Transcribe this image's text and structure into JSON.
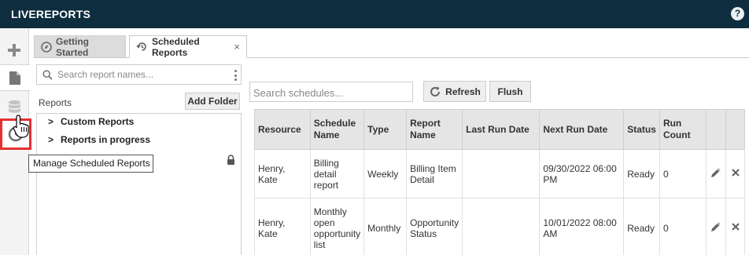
{
  "app": {
    "title": "LIVEREPORTS",
    "help_icon": "question-circle-icon",
    "help_label": "?"
  },
  "rail": {
    "items": [
      {
        "name": "add",
        "icon": "plus-icon"
      },
      {
        "name": "reports",
        "icon": "document-icon"
      },
      {
        "name": "database",
        "icon": "database-icon"
      },
      {
        "name": "scheduled",
        "icon": "clock-icon"
      }
    ]
  },
  "tabs": [
    {
      "label": "Getting Started",
      "icon": "compass-icon",
      "active": false
    },
    {
      "label": "Scheduled Reports",
      "icon": "clock-refresh-icon",
      "active": true,
      "close": "×"
    }
  ],
  "sidebar": {
    "search_placeholder": "Search report names...",
    "reports_label": "Reports",
    "add_folder_label": "Add Folder",
    "tree": [
      {
        "label": "Custom Reports",
        "chevron": ">"
      },
      {
        "label": "Reports in progress",
        "chevron": ">"
      }
    ]
  },
  "tooltip": {
    "text": "Manage Scheduled Reports"
  },
  "schedules": {
    "search_placeholder": "Search schedules...",
    "refresh_label": "Refresh",
    "flush_label": "Flush",
    "columns": [
      "Resource",
      "Schedule Name",
      "Type",
      "Report Name",
      "Last Run Date",
      "Next Run Date",
      "Status",
      "Run Count"
    ],
    "rows": [
      {
        "resource": "Henry, Kate",
        "schedule_name": "Billing detail report",
        "type": "Weekly",
        "report_name": "Billing Item Detail",
        "last_run_date": "",
        "next_run_date": "09/30/2022 06:00 PM",
        "status": "Ready",
        "run_count": "0"
      },
      {
        "resource": "Henry, Kate",
        "schedule_name": "Monthly open opportunity list",
        "type": "Monthly",
        "report_name": "Opportunity Status",
        "last_run_date": "",
        "next_run_date": "10/01/2022 08:00 AM",
        "status": "Ready",
        "run_count": "0"
      }
    ]
  },
  "colors": {
    "topbar": "#0e2d3f",
    "highlight": "#e3312f",
    "header_bg": "#e5e5e5"
  }
}
